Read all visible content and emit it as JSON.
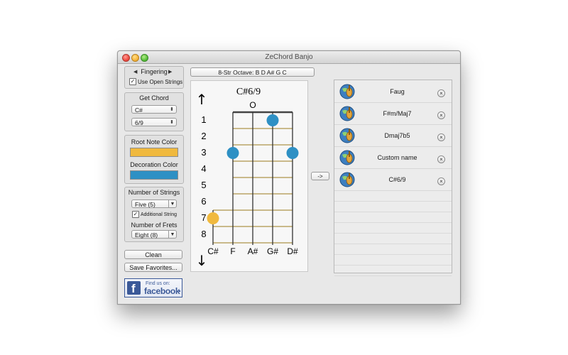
{
  "window": {
    "title": "ZeChord Banjo"
  },
  "fingering": {
    "label": "Fingering",
    "left_arrow": "◀",
    "right_arrow": "▶",
    "use_open_strings_label": "Use Open Strings",
    "use_open_strings_checked": true
  },
  "get_chord": {
    "label": "Get Chord",
    "root_value": "C#",
    "type_value": "6/9"
  },
  "colors": {
    "root_label": "Root Note Color",
    "root_color": "#f0b93e",
    "decoration_label": "Decoration Color",
    "decoration_color": "#2e90c4"
  },
  "strings": {
    "number_label": "Number of Strings",
    "number_value": "Five (5)",
    "additional_label": "Additional String",
    "additional_checked": true,
    "frets_label": "Number of Frets",
    "frets_value": "Eight (8)"
  },
  "buttons": {
    "clean": "Clean",
    "save_favorites": "Save Favorites...",
    "transfer": "->"
  },
  "facebook": {
    "line1": "Find us on:",
    "line2": "facebook",
    "logo_letter": "f"
  },
  "tuning_button": "8-Str Octave: B D A# G C",
  "chord": {
    "name": "C#6/9",
    "open_marker": "O",
    "fret_numbers": [
      "1",
      "2",
      "3",
      "4",
      "5",
      "6",
      "7",
      "8"
    ],
    "string_names": [
      "C#",
      "F",
      "A#",
      "G#",
      "D#"
    ],
    "up_arrow": "↑",
    "down_arrow": "↓"
  },
  "favorites": [
    {
      "name": "Faug"
    },
    {
      "name": "F#m/Maj7"
    },
    {
      "name": "Dmaj7b5"
    },
    {
      "name": "Custom name"
    },
    {
      "name": "C#6/9"
    }
  ],
  "close_glyph": "×"
}
